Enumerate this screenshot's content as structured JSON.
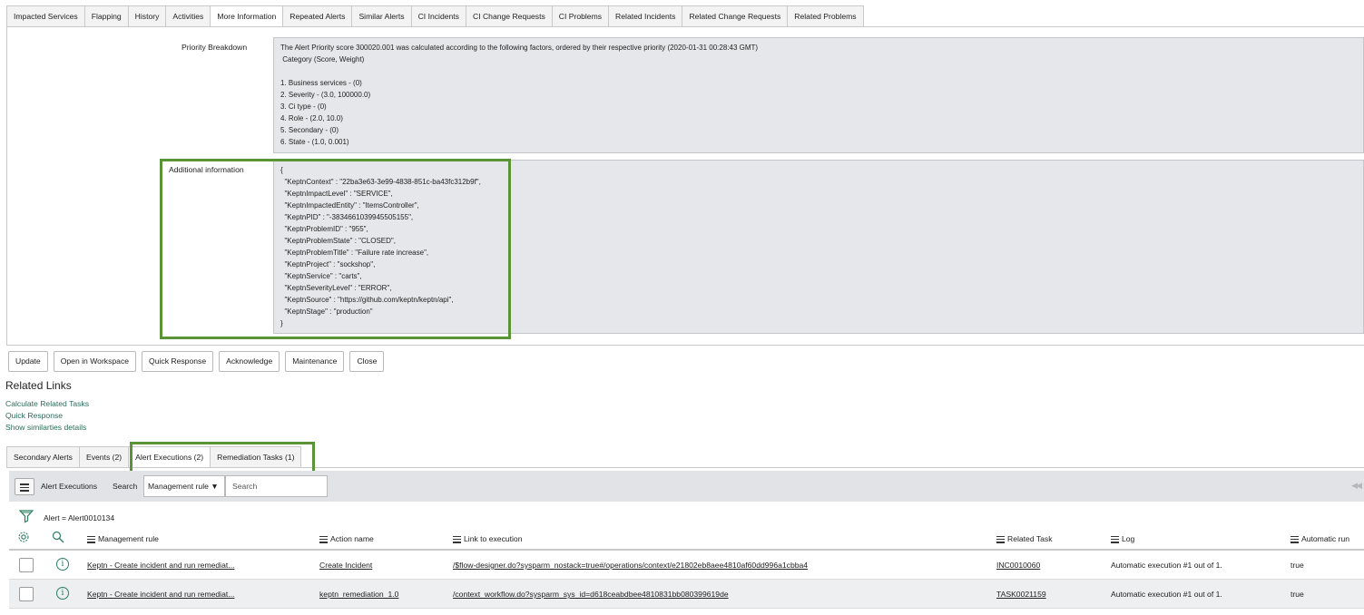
{
  "top_tabs": [
    "Impacted Services",
    "Flapping",
    "History",
    "Activities",
    "More Information",
    "Repeated Alerts",
    "Similar Alerts",
    "CI Incidents",
    "CI Change Requests",
    "CI Problems",
    "Related Incidents",
    "Related Change Requests",
    "Related Problems"
  ],
  "active_top_tab": "More Information",
  "priority": {
    "label": "Priority Breakdown",
    "text": "The Alert Priority score 300020.001 was calculated according to the following factors, ordered by their respective priority (2020-01-31 00:28:43 GMT)\n Category (Score, Weight)\n\n1. Business services - (0)\n2. Severity - (3.0, 100000.0)\n3. Ci type - (0)\n4. Role - (2.0, 10.0)\n5. Secondary - (0)\n6. State - (1.0, 0.001)"
  },
  "additional": {
    "label": "Additional information",
    "text": "{\n  \"KeptnContext\" : \"22ba3e63-3e99-4838-851c-ba43fc312b9f\",\n  \"KeptnImpactLevel\" : \"SERVICE\",\n  \"KeptnImpactedEntity\" : \"ItemsController\",\n  \"KeptnPID\" : \"-3834661039945505155\",\n  \"KeptnProblemID\" : \"955\",\n  \"KeptnProblemState\" : \"CLOSED\",\n  \"KeptnProblemTitle\" : \"Failure rate increase\",\n  \"KeptnProject\" : \"sockshop\",\n  \"KeptnService\" : \"carts\",\n  \"KeptnSeverityLevel\" : \"ERROR\",\n  \"KeptnSource\" : \"https://github.com/keptn/keptn/api\",\n  \"KeptnStage\" : \"production\"\n}"
  },
  "buttons": [
    "Update",
    "Open in Workspace",
    "Quick Response",
    "Acknowledge",
    "Maintenance",
    "Close"
  ],
  "related_links": {
    "title": "Related Links",
    "items": [
      "Calculate Related Tasks",
      "Quick Response",
      "Show similarties details"
    ]
  },
  "bottom_tabs": [
    "Secondary Alerts",
    "Events (2)",
    "Alert Executions (2)",
    "Remediation Tasks (1)"
  ],
  "active_bottom_tab": "Alert Executions (2)",
  "list": {
    "title": "Alert Executions",
    "search_label": "Search",
    "search_field": "Management rule",
    "search_placeholder": "Search",
    "filter": "Alert = Alert0010134",
    "columns": [
      "Management rule",
      "Action name",
      "Link to execution",
      "Related Task",
      "Log",
      "Automatic run"
    ],
    "rows": [
      [
        "Keptn - Create incident and run remediat...",
        "Create Incident",
        "/$flow-designer.do?sysparm_nostack=true#/operations/context/e21802eb8aee4810af60dd996a1cbba4",
        "INC0010060",
        "Automatic execution #1 out of 1.",
        "true"
      ],
      [
        "Keptn - Create incident and run remediat...",
        "keptn_remediation_1.0",
        "/context_workflow.do?sysparm_sys_id=d618ceabdbee4810831bb080399619de",
        "TASK0021159",
        "Automatic execution #1 out of 1.",
        "true"
      ]
    ]
  },
  "colors": {
    "highlight": "#5a9437",
    "link": "#2a6c59",
    "field_bg": "#e5e7ea"
  }
}
